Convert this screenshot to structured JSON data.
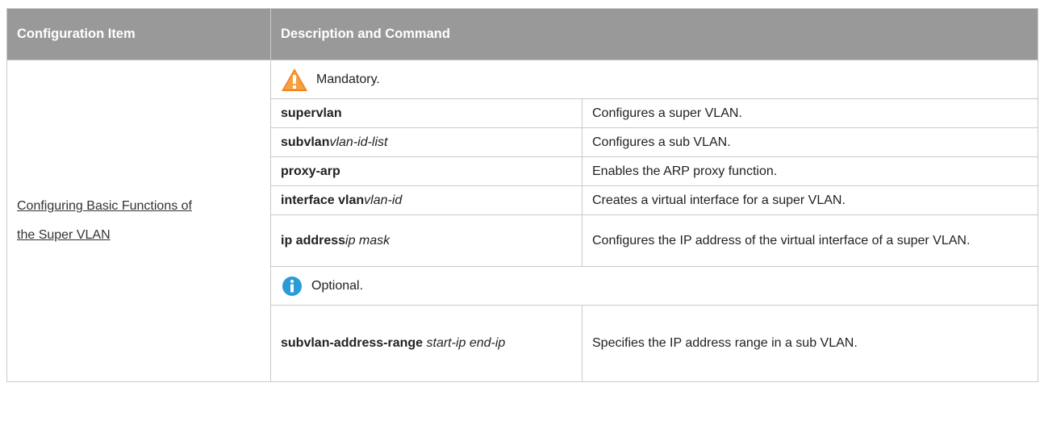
{
  "table": {
    "headers": [
      "Configuration Item",
      "Description and Command"
    ],
    "item": {
      "line1": "Configuring Basic Functions of",
      "line2": "the Super VLAN"
    },
    "mandatory": "Mandatory.",
    "optional": "Optional.",
    "rows": [
      {
        "cmd_bold": "supervlan",
        "cmd_italic": "",
        "desc": "Configures a super VLAN."
      },
      {
        "cmd_bold": "subvlan",
        "cmd_italic": "vlan-id-list",
        "desc": "Configures a sub VLAN."
      },
      {
        "cmd_bold": "proxy-arp",
        "cmd_italic": "",
        "desc": "Enables the ARP proxy function."
      },
      {
        "cmd_bold": "interface vlan",
        "cmd_italic": "vlan-id",
        "desc": "Creates a virtual interface for a super VLAN."
      },
      {
        "cmd_bold": "ip address",
        "cmd_italic": "ip mask",
        "desc": "Configures the IP address of the virtual interface of a super VLAN."
      }
    ],
    "optional_rows": [
      {
        "cmd_bold": "subvlan-address-range",
        "cmd_italic": " start-ip end-ip",
        "desc": "Specifies the IP address range in a sub VLAN."
      }
    ]
  },
  "colors": {
    "header_bg": "#999999",
    "border": "#c9c9c9",
    "warning": "#f0821e",
    "info": "#2a9bd6"
  },
  "icons": {
    "mandatory": "warning-icon",
    "optional": "info-icon"
  }
}
